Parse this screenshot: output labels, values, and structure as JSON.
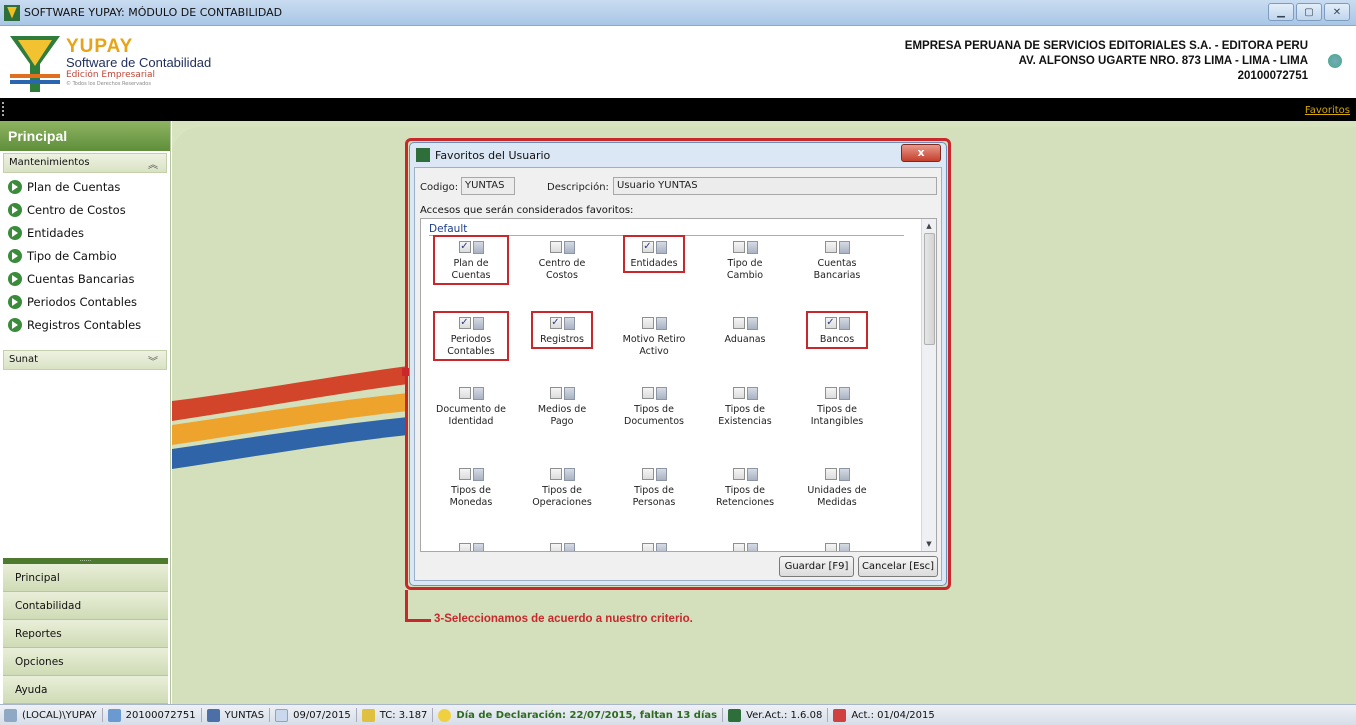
{
  "window": {
    "title": "SOFTWARE YUPAY: MÓDULO DE CONTABILIDAD",
    "buttons": [
      "▁",
      "▢",
      "✕"
    ]
  },
  "brand": {
    "name": "YUPAY",
    "subtitle": "Software de Contabilidad",
    "edition": "Edición Empresarial",
    "rights": "© Todos los Derechos Reservados"
  },
  "company": {
    "line1": "EMPRESA PERUANA DE SERVICIOS EDITORIALES S.A. - EDITORA PERU",
    "line2": "AV. ALFONSO UGARTE NRO. 873 LIMA - LIMA - LIMA",
    "line3": "20100072751"
  },
  "favorites_link": "Favoritos",
  "sidebar": {
    "header": "Principal",
    "section1": {
      "label": "Mantenimientos",
      "chevron": "︽",
      "items": [
        "Plan de Cuentas",
        "Centro de Costos",
        "Entidades",
        "Tipo de Cambio",
        "Cuentas Bancarias",
        "Periodos Contables",
        "Registros Contables"
      ]
    },
    "section2": {
      "label": "Sunat",
      "chevron": "︾"
    },
    "splitter": "......",
    "bottom": [
      "Principal",
      "Contabilidad",
      "Reportes",
      "Opciones",
      "Ayuda"
    ]
  },
  "dialog": {
    "title": "Favoritos del Usuario",
    "close": "x",
    "codigo_label": "Codigo:",
    "codigo_value": "YUNTAS",
    "descripcion_label": "Descripción:",
    "descripcion_value": "Usuario YUNTAS",
    "group_caption": "Accesos que serán considerados favoritos:",
    "group_name": "Default",
    "items": [
      {
        "label": "Plan de\nCuentas",
        "checked": true,
        "highlighted": true
      },
      {
        "label": "Centro de\nCostos",
        "checked": false,
        "highlighted": false
      },
      {
        "label": "Entidades",
        "checked": true,
        "highlighted": true
      },
      {
        "label": "Tipo de\nCambio",
        "checked": false,
        "highlighted": false
      },
      {
        "label": "Cuentas\nBancarias",
        "checked": false,
        "highlighted": false
      },
      {
        "label": "Periodos\nContables",
        "checked": true,
        "highlighted": true
      },
      {
        "label": "Registros",
        "checked": true,
        "highlighted": true
      },
      {
        "label": "Motivo Retiro\nActivo",
        "checked": false,
        "highlighted": false
      },
      {
        "label": "Aduanas",
        "checked": false,
        "highlighted": false
      },
      {
        "label": "Bancos",
        "checked": true,
        "highlighted": true
      },
      {
        "label": "Documento de\nIdentidad",
        "checked": false,
        "highlighted": false
      },
      {
        "label": "Medios de\nPago",
        "checked": false,
        "highlighted": false
      },
      {
        "label": "Tipos de\nDocumentos",
        "checked": false,
        "highlighted": false
      },
      {
        "label": "Tipos de\nExistencias",
        "checked": false,
        "highlighted": false
      },
      {
        "label": "Tipos de\nIntangibles",
        "checked": false,
        "highlighted": false
      },
      {
        "label": "Tipos de\nMonedas",
        "checked": false,
        "highlighted": false
      },
      {
        "label": "Tipos de\nOperaciones",
        "checked": false,
        "highlighted": false
      },
      {
        "label": "Tipos de\nPersonas",
        "checked": false,
        "highlighted": false
      },
      {
        "label": "Tipos de\nRetenciones",
        "checked": false,
        "highlighted": false
      },
      {
        "label": "Unidades de\nMedidas",
        "checked": false,
        "highlighted": false
      },
      {
        "label": "",
        "checked": false,
        "highlighted": false
      },
      {
        "label": "",
        "checked": false,
        "highlighted": false
      },
      {
        "label": "",
        "checked": false,
        "highlighted": false
      },
      {
        "label": "",
        "checked": false,
        "highlighted": false
      },
      {
        "label": "",
        "checked": false,
        "highlighted": false
      }
    ],
    "save_button": "Guardar [F9]",
    "cancel_button": "Cancelar [Esc]"
  },
  "annotation": "3-Seleccionamos de acuerdo a nuestro criterio.",
  "statusbar": {
    "server": "(LOCAL)\\YUPAY",
    "ruc": "20100072751",
    "user": "YUNTAS",
    "date": "09/07/2015",
    "tc": "TC: 3.187",
    "declaracion": "Día de Declaración: 22/07/2015, faltan 13 días",
    "version": "Ver.Act.: 1.6.08",
    "act": "Act.: 01/04/2015"
  },
  "colors": {
    "accent_green": "#5f8e3a",
    "highlight_red": "#c8282c",
    "stripe_red": "#d2452a",
    "stripe_orange": "#eea32c",
    "stripe_blue": "#2f65a8"
  }
}
